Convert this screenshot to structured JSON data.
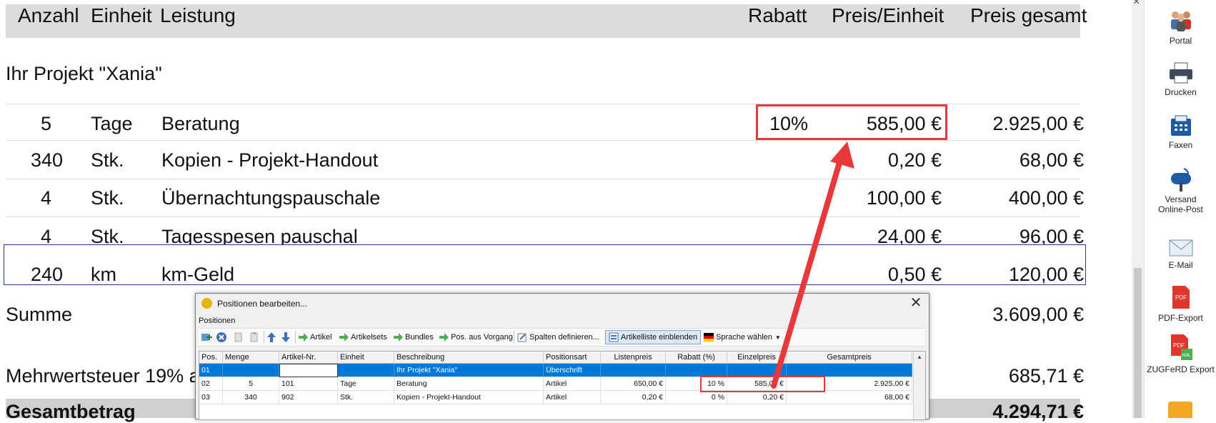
{
  "invoice": {
    "headers": {
      "anzahl": "Anzahl",
      "einheit": "Einheit",
      "leistung": "Leistung",
      "rabatt": "Rabatt",
      "preis_einheit": "Preis/Einheit",
      "preis_gesamt": "Preis gesamt"
    },
    "heading": "Ihr Projekt \"Xania\"",
    "rows": [
      {
        "anzahl": "5",
        "einheit": "Tage",
        "leistung": "Beratung",
        "rabatt": "10%",
        "preis_einheit": "585,00 €",
        "preis_gesamt": "2.925,00 €"
      },
      {
        "anzahl": "340",
        "einheit": "Stk.",
        "leistung": "Kopien - Projekt-Handout",
        "rabatt": "",
        "preis_einheit": "0,20 €",
        "preis_gesamt": "68,00 €"
      },
      {
        "anzahl": "4",
        "einheit": "Stk.",
        "leistung": "Übernachtungspauschale",
        "rabatt": "",
        "preis_einheit": "100,00 €",
        "preis_gesamt": "400,00 €"
      },
      {
        "anzahl": "4",
        "einheit": "Stk.",
        "leistung": "Tagesspesen pauschal",
        "rabatt": "",
        "preis_einheit": "24,00 €",
        "preis_gesamt": "96,00 €"
      },
      {
        "anzahl": "240",
        "einheit": "km",
        "leistung": "km-Geld",
        "rabatt": "",
        "preis_einheit": "0,50 €",
        "preis_gesamt": "120,00 €"
      }
    ],
    "summe_label": "Summe",
    "summe_value": "3.609,00 €",
    "mwst_label": "Mehrwertsteuer 19% a",
    "mwst_value": "685,71 €",
    "gesamt_label": "Gesamtbetrag",
    "gesamt_value": "4.294,71 €"
  },
  "sidepanel": {
    "items": [
      {
        "label": "Portal",
        "icon": "people-icon"
      },
      {
        "label": "Drucken",
        "icon": "printer-icon"
      },
      {
        "label": "Faxen",
        "icon": "fax-icon"
      },
      {
        "label": "Versand",
        "label2": "Online-Post",
        "icon": "mailbox-icon"
      },
      {
        "label": "E-Mail",
        "icon": "envelope-icon"
      },
      {
        "label": "PDF-Export",
        "icon": "pdf-icon"
      },
      {
        "label": "ZUGFeRD Export",
        "icon": "pdf-xml-icon"
      }
    ],
    "close_glyph": "×"
  },
  "dialog": {
    "title": "Positionen bearbeiten...",
    "close": "✕",
    "section": "Positionen",
    "toolbar": {
      "artikel": "Artikel",
      "artikelsets": "Artikelsets",
      "bundles": "Bundles",
      "pos_aus_vorgang": "Pos. aus Vorgang",
      "spalten": "Spalten definieren...",
      "artikelliste": "Artikelliste einblenden",
      "sprache": "Sprache wählen"
    },
    "columns": [
      "Pos.",
      "Menge",
      "Artikel-Nr.",
      "Einheit",
      "Beschreibung",
      "Positionsart",
      "Listenpreis",
      "Rabatt (%)",
      "Einzelpreis",
      "Gesamtpreis"
    ],
    "rows": [
      {
        "pos": "01",
        "menge": "",
        "artnr": "",
        "einheit": "",
        "beschreibung": "Ihr Projekt \"Xania\"",
        "art": "Überschrift",
        "listen": "",
        "rabatt": "",
        "einzel": "",
        "gesamt": ""
      },
      {
        "pos": "02",
        "menge": "5",
        "artnr": "101",
        "einheit": "Tage",
        "beschreibung": "Beratung",
        "art": "Artikel",
        "listen": "650,00 €",
        "rabatt": "10 %",
        "einzel": "585,00 €",
        "gesamt": "2.925,00 €"
      },
      {
        "pos": "03",
        "menge": "340",
        "artnr": "902",
        "einheit": "Stk.",
        "beschreibung": "Kopien - Projekt-Handout",
        "art": "Artikel",
        "listen": "0,20 €",
        "rabatt": "0 %",
        "einzel": "0,20 €",
        "gesamt": "68,00 €"
      }
    ]
  },
  "colors": {
    "highlight": "#e8383a",
    "selection": "#0078d7",
    "header_bg": "#dcdcdc"
  }
}
